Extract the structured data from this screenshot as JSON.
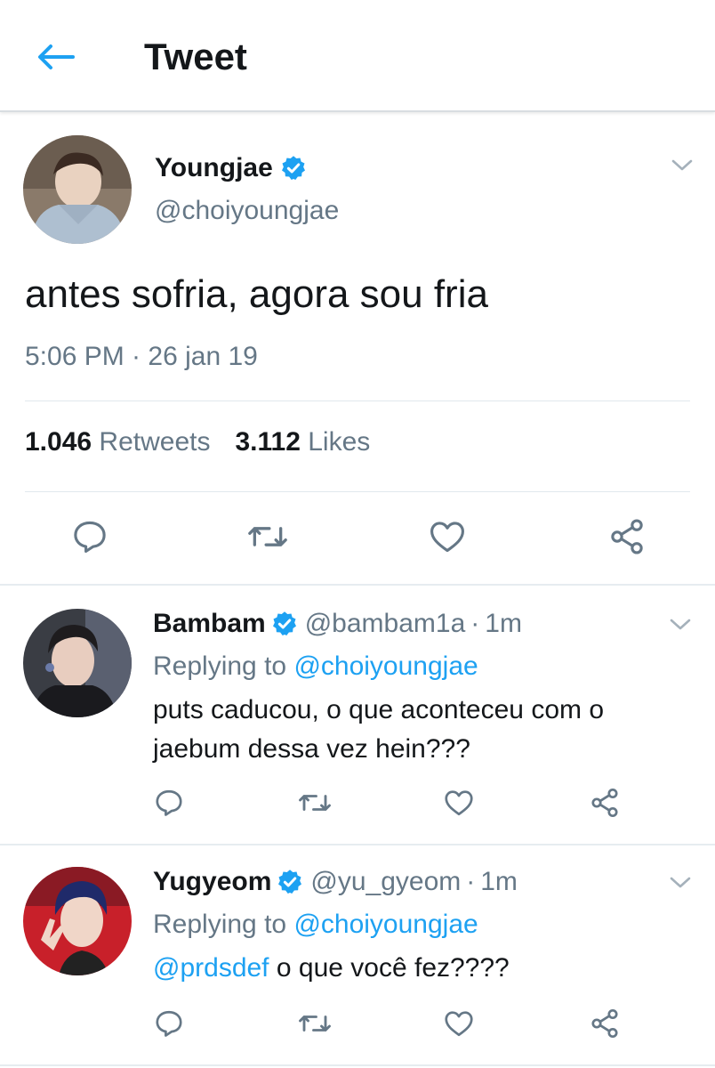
{
  "header": {
    "title": "Tweet",
    "back_icon": "arrow-left-icon"
  },
  "colors": {
    "accent": "#1da1f2",
    "secondary_text": "#657786",
    "divider": "#e6ecf0"
  },
  "main_tweet": {
    "author_name": "Youngjae",
    "author_handle": "@choiyoungjae",
    "text": "antes sofria, agora sou fria",
    "timestamp": "5:06 PM · 26 jan 19",
    "retweets_count": "1.046",
    "retweets_label": "Retweets",
    "likes_count": "3.112",
    "likes_label": "Likes",
    "actions": [
      "reply-icon",
      "retweet-icon",
      "like-icon",
      "share-icon"
    ]
  },
  "replies": [
    {
      "author_name": "Bambam",
      "author_handle": "@bambam1a",
      "separator": "·",
      "time": "1m",
      "replying_prefix": "Replying to ",
      "replying_to": "@choiyoungjae",
      "body_line1": "puts caducou, o que aconteceu com o",
      "body_line2": "jaebum dessa vez hein???"
    },
    {
      "author_name": "Yugyeom",
      "author_handle": "@yu_gyeom",
      "separator": "·",
      "time": "1m",
      "replying_prefix": "Replying to ",
      "replying_to": "@choiyoungjae",
      "body_mention": "@prdsdef",
      "body_text": " o que você fez????"
    }
  ]
}
